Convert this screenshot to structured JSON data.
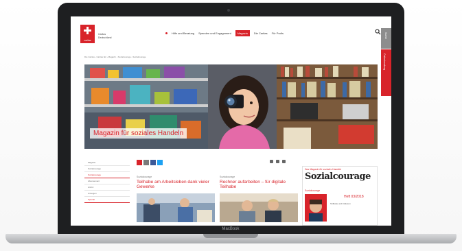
{
  "device": {
    "label": "MacBook"
  },
  "site": {
    "logo_text": "caritas",
    "org_name_line1": "Caritas",
    "org_name_line2": "Deutschland",
    "nav": [
      {
        "label": "Hilfe und Beratung"
      },
      {
        "label": "Spenden und Engagement"
      },
      {
        "label": "Magazin",
        "active": true
      },
      {
        "label": "Die Caritas"
      },
      {
        "label": "Für Profis"
      }
    ],
    "side_tab_gray": "Suche",
    "side_tab_red": "Onlineberatung",
    "breadcrumb": "Die Caritas › Caritas fair › Magazin › Sozialcourage › Sozialcourage",
    "accent_color": "#d8232a"
  },
  "hero": {
    "caption": "Magazin für soziales Handeln"
  },
  "sidemenu": {
    "items": [
      {
        "label": "Magazin"
      },
      {
        "label": "Sozialcourage"
      },
      {
        "label": "Sozialcourage",
        "highlight": true
      },
      {
        "label": "Abonnement"
      },
      {
        "label": "Archiv"
      },
      {
        "label": "Anzeigen"
      },
      {
        "label": "Special"
      }
    ]
  },
  "cards": [
    {
      "kicker": "Sozialcourage",
      "headline": "Teilhabe am Arbeitsleben dank vieler Gewerke"
    },
    {
      "kicker": "Sozialcourage",
      "headline": "Rechner aufarbeiten – für digitale Teilhabe"
    }
  ],
  "magazine": {
    "tag": "Das Magazin für soziales Handeln",
    "title": "Sozialcourage",
    "sub": "Sozialcourage",
    "issue": "Heft 03/2018",
    "blurb": "Teilhabe und Inklusion"
  }
}
